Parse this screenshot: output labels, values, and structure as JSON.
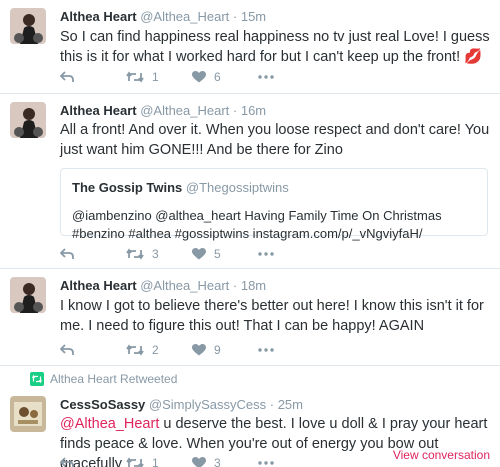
{
  "tweets": [
    {
      "name": "Althea Heart",
      "handle": "@Althea_Heart",
      "time": "· 15m",
      "text": "So I can find happiness real happiness no tv just real Love! I guess this is it for what I worked hard for but I can't keep up the front! 💋",
      "retweets": "1",
      "likes": "6"
    },
    {
      "name": "Althea Heart",
      "handle": "@Althea_Heart",
      "time": "· 16m",
      "text": "All a front!   And over it. When you loose respect and don't care! You just want him GONE!!! And be there for Zino",
      "retweets": "3",
      "likes": "5",
      "quote": {
        "name": "The Gossip Twins",
        "handle": "@Thegossiptwins",
        "text": "@iambenzino @althea_heart Having Family Time On Christmas #benzino #althea #gossiptwins instagram.com/p/_vNgviyfaH/"
      }
    },
    {
      "name": "Althea Heart",
      "handle": "@Althea_Heart",
      "time": "· 18m",
      "text": "I know I got to believe there's better out here! I know this isn't it for me. I need to figure this out! That I can be happy!  AGAIN",
      "retweets": "2",
      "likes": "9"
    },
    {
      "retweet_note": "Althea Heart Retweeted",
      "name": "CessSoSassy",
      "handle": "@SimplySassyCess",
      "time": "· 25m",
      "mention": "@Althea_Heart",
      "text": " u deserve the best. I love u doll & I pray your heart finds peace & love. When you're out of energy you bow out gracefully",
      "retweets": "1",
      "likes": "3",
      "view_conversation": "View conversation"
    }
  ],
  "colors": {
    "accent": "#e0245e",
    "muted": "#8899a6",
    "text": "#292f33",
    "retweet_green": "#19cf86"
  },
  "icons": [
    "reply-icon",
    "retweet-icon",
    "like-icon",
    "more-icon"
  ]
}
